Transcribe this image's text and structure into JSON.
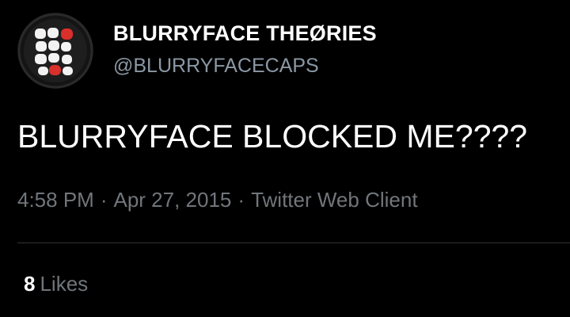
{
  "tweet": {
    "author": {
      "display_name": "BLURRYFACE THEØRIES",
      "handle": "@BLURRYFACECAPS",
      "avatar_icon": "blurryface-avatar-icon"
    },
    "text": "BLURRYFACE BLOCKED ME????",
    "time": "4:58 PM",
    "date": "Apr 27, 2015",
    "source": "Twitter Web Client",
    "separator": "·",
    "likes": {
      "count": "8",
      "label": "Likes"
    }
  },
  "colors": {
    "background": "#000000",
    "primary_text": "#ffffff",
    "secondary_text": "#71767b",
    "divider": "#2f3336",
    "avatar_accent": "#d9302c"
  }
}
